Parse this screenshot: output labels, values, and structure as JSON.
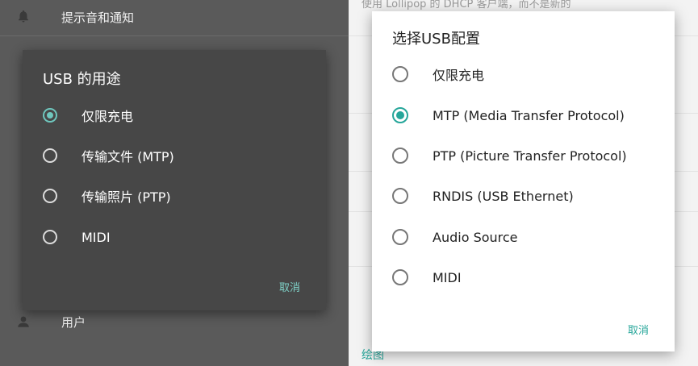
{
  "background_settings": {
    "top_item": "提示音和通知",
    "bottom_item": "用户",
    "right_top_text": "使用 Lollipop 的 DHCP 客户端，而不是新的",
    "right_bottom_text": "绘图"
  },
  "usb_purpose_dialog": {
    "title": "USB 的用途",
    "options": [
      {
        "label": "仅限充电",
        "selected": true
      },
      {
        "label": "传输文件 (MTP)",
        "selected": false
      },
      {
        "label": "传输照片 (PTP)",
        "selected": false
      },
      {
        "label": "MIDI",
        "selected": false
      }
    ],
    "cancel_label": "取消"
  },
  "usb_config_dialog": {
    "title": "选择USB配置",
    "options": [
      {
        "label": "仅限充电",
        "selected": false
      },
      {
        "label": "MTP (Media Transfer Protocol)",
        "selected": true
      },
      {
        "label": "PTP (Picture Transfer Protocol)",
        "selected": false
      },
      {
        "label": "RNDIS (USB Ethernet)",
        "selected": false
      },
      {
        "label": "Audio Source",
        "selected": false
      },
      {
        "label": "MIDI",
        "selected": false
      }
    ],
    "cancel_label": "取消"
  },
  "colors": {
    "accent_dark": "#6fc7be",
    "accent_light": "#26a69a"
  }
}
